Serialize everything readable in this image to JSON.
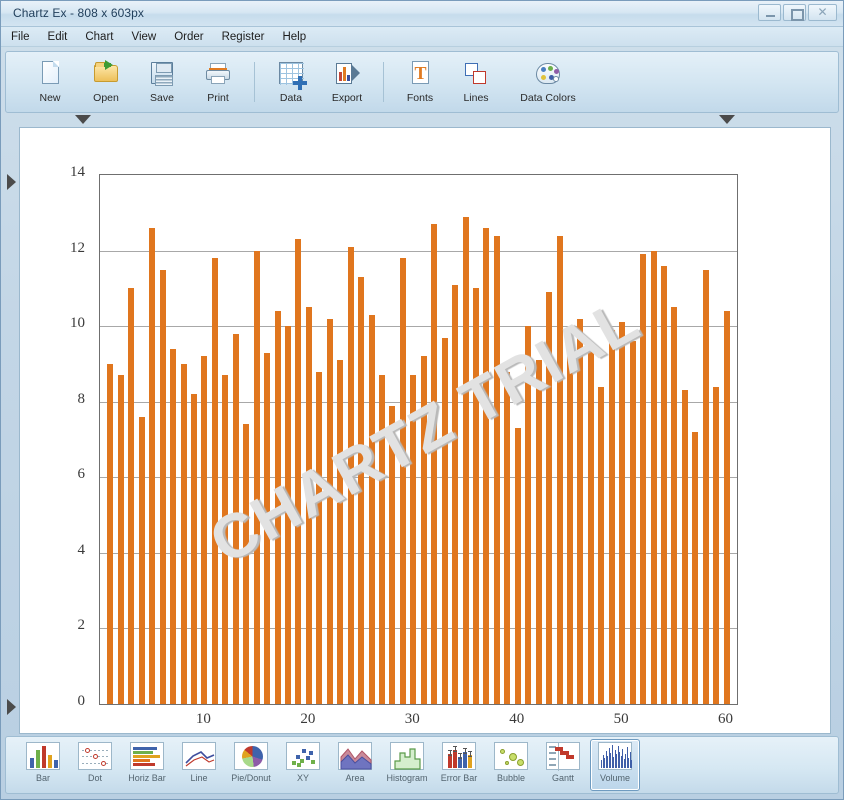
{
  "window": {
    "title": "Chartz Ex - 808 x 603px",
    "controls": [
      {
        "name": "minimize",
        "glyph": "—"
      },
      {
        "name": "maximize",
        "glyph": "▫"
      },
      {
        "name": "close",
        "glyph": "✕"
      }
    ]
  },
  "menu": {
    "items": [
      "File",
      "Edit",
      "Chart",
      "View",
      "Order",
      "Register",
      "Help"
    ]
  },
  "toolbar": {
    "buttons": [
      {
        "label": "New",
        "icon": "new-page-icon"
      },
      {
        "label": "Open",
        "icon": "open-folder-icon"
      },
      {
        "label": "Save",
        "icon": "floppy-disk-icon"
      },
      {
        "label": "Print",
        "icon": "printer-icon"
      },
      {
        "label": "Data",
        "icon": "data-grid-icon"
      },
      {
        "label": "Export",
        "icon": "export-icon"
      },
      {
        "label": "Fonts",
        "icon": "fonts-icon"
      },
      {
        "label": "Lines",
        "icon": "lines-icon"
      },
      {
        "label": "Data Colors",
        "icon": "color-palette-icon"
      }
    ]
  },
  "gallery": {
    "buttons": [
      {
        "label": "Bar",
        "icon": "bar-chart-icon",
        "selected": false
      },
      {
        "label": "Dot",
        "icon": "dot-plot-icon",
        "selected": false
      },
      {
        "label": "Horiz Bar",
        "icon": "horiz-bar-icon",
        "selected": false
      },
      {
        "label": "Line",
        "icon": "line-chart-icon",
        "selected": false
      },
      {
        "label": "Pie/Donut",
        "icon": "pie-chart-icon",
        "selected": false
      },
      {
        "label": "XY",
        "icon": "xy-scatter-icon",
        "selected": false
      },
      {
        "label": "Area",
        "icon": "area-chart-icon",
        "selected": false
      },
      {
        "label": "Histogram",
        "icon": "histogram-icon",
        "selected": false
      },
      {
        "label": "Error Bar",
        "icon": "error-bar-icon",
        "selected": false
      },
      {
        "label": "Bubble",
        "icon": "bubble-chart-icon",
        "selected": false
      },
      {
        "label": "Gantt",
        "icon": "gantt-chart-icon",
        "selected": false
      },
      {
        "label": "Volume",
        "icon": "volume-chart-icon",
        "selected": true
      }
    ]
  },
  "colors": {
    "bar": "#e0761e",
    "grid": "#8b8b8b",
    "plot_border": "#6f6f6f",
    "watermark": "#e2e2e2",
    "chrome": "#c3d6e6"
  },
  "watermark": {
    "text": "CHARTZ TRIAL"
  },
  "chart_data": {
    "type": "bar",
    "title": "",
    "xlabel": "",
    "ylabel": "",
    "xlim": [
      0,
      61
    ],
    "ylim": [
      0,
      14
    ],
    "ytick_step": 2,
    "yticks": [
      0,
      2,
      4,
      6,
      8,
      10,
      12,
      14
    ],
    "xticks": [
      10,
      20,
      30,
      40,
      50,
      60
    ],
    "grid": true,
    "legend": false,
    "x": [
      1,
      2,
      3,
      4,
      5,
      6,
      7,
      8,
      9,
      10,
      11,
      12,
      13,
      14,
      15,
      16,
      17,
      18,
      19,
      20,
      21,
      22,
      23,
      24,
      25,
      26,
      27,
      28,
      29,
      30,
      31,
      32,
      33,
      34,
      35,
      36,
      37,
      38,
      39,
      40,
      41,
      42,
      43,
      44,
      45,
      46,
      47,
      48,
      49,
      50,
      51,
      52,
      53,
      54,
      55,
      56,
      57,
      58,
      59,
      60
    ],
    "values": [
      9.0,
      8.7,
      11.0,
      7.6,
      12.6,
      11.5,
      9.4,
      9.0,
      8.2,
      9.2,
      11.8,
      8.7,
      9.8,
      7.4,
      12.0,
      9.3,
      10.4,
      10.0,
      12.3,
      10.5,
      8.8,
      10.2,
      9.1,
      12.1,
      11.3,
      10.3,
      8.7,
      7.9,
      11.8,
      8.7,
      9.2,
      12.7,
      9.7,
      11.1,
      12.9,
      11.0,
      12.6,
      12.4,
      8.8,
      7.3,
      10.0,
      9.1,
      10.9,
      12.4,
      9.6,
      10.2,
      9.4,
      8.4,
      9.9,
      10.1,
      9.6,
      11.9,
      12.0,
      11.6,
      10.5,
      8.3,
      7.2,
      11.5,
      8.4,
      10.4
    ]
  }
}
